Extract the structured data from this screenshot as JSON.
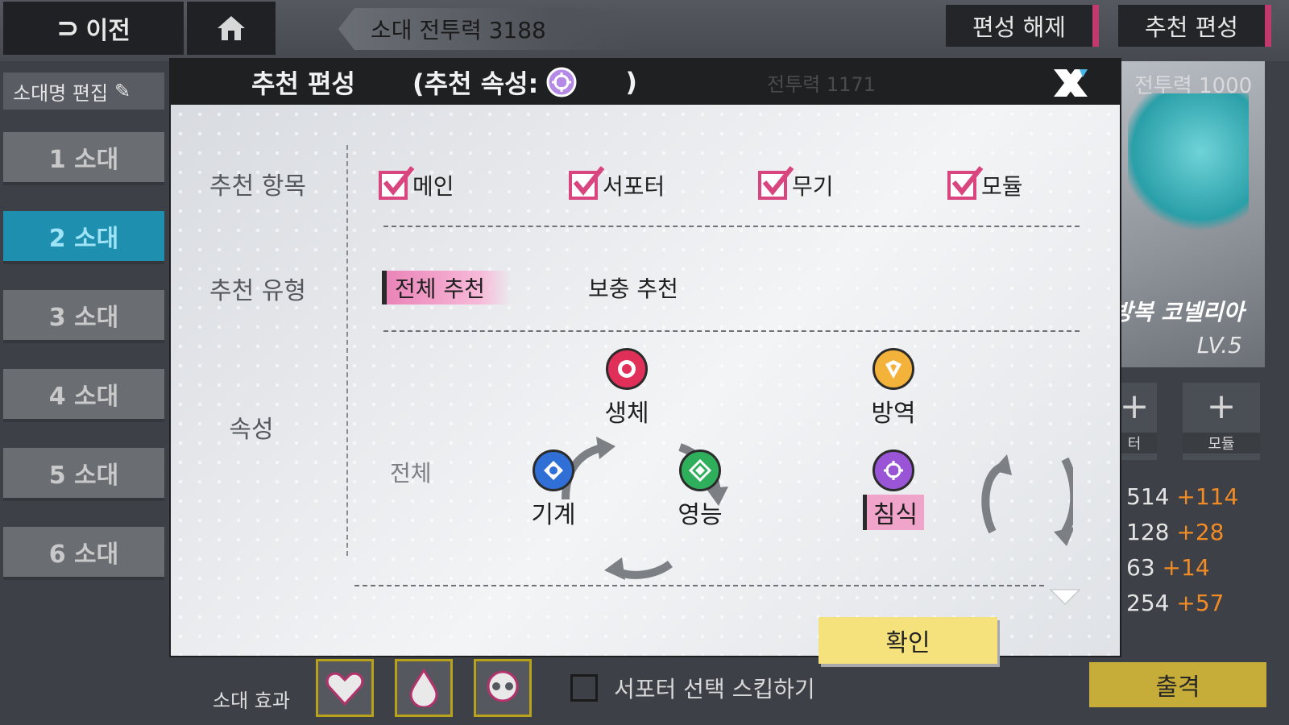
{
  "topbar": {
    "back_label": "이전",
    "squad_power": "소대 전투력 3188",
    "disband_label": "편성 해제",
    "recommend_label": "추천 편성"
  },
  "sidebar": {
    "rename_label": "소대명 편집",
    "squads": [
      {
        "label": "1 소대",
        "active": false
      },
      {
        "label": "2 소대",
        "active": true
      },
      {
        "label": "3 소대",
        "active": false
      },
      {
        "label": "4 소대",
        "active": false
      },
      {
        "label": "5 소대",
        "active": false
      },
      {
        "label": "6 소대",
        "active": false
      }
    ]
  },
  "character_card": {
    "power": "전투력 1000",
    "name": "방복 코넬리아",
    "level": "LV.5",
    "slot_supporter": "터",
    "slot_module": "모듈",
    "stats": [
      {
        "value": "514",
        "bonus": "+114"
      },
      {
        "value": "128",
        "bonus": "+28"
      },
      {
        "value": "63",
        "bonus": "+14"
      },
      {
        "value": "254",
        "bonus": "+57"
      }
    ],
    "sortie_label": "출격"
  },
  "bottom": {
    "squad_effect_label": "소대 효과",
    "skip_label": "서포터 선택 스킵하기"
  },
  "modal": {
    "title": "추천 편성",
    "attr_prefix": "(추천 속성:",
    "attr_suffix": ")",
    "ghost_power": "전투력 1171",
    "rows": {
      "items_label": "추천 항목",
      "type_label": "추천 유형",
      "attr_label": "속성"
    },
    "items": [
      {
        "label": "메인",
        "checked": true
      },
      {
        "label": "서포터",
        "checked": true
      },
      {
        "label": "무기",
        "checked": true
      },
      {
        "label": "모듈",
        "checked": true
      }
    ],
    "types": [
      {
        "label": "전체 추천",
        "selected": true
      },
      {
        "label": "보충 추천",
        "selected": false
      }
    ],
    "attr_all": "전체",
    "attributes": [
      {
        "name": "생체",
        "color": "#e0305a",
        "selected": false
      },
      {
        "name": "기계",
        "color": "#2f6fd6",
        "selected": false
      },
      {
        "name": "영능",
        "color": "#2fae5c",
        "selected": false
      },
      {
        "name": "방역",
        "color": "#f3b23a",
        "selected": false
      },
      {
        "name": "침식",
        "color": "#9a55d6",
        "selected": true
      }
    ],
    "confirm_label": "확인"
  },
  "colors": {
    "accent_pink": "#d9457f",
    "active_tab": "#1f8fb0",
    "confirm": "#f6e27c"
  }
}
